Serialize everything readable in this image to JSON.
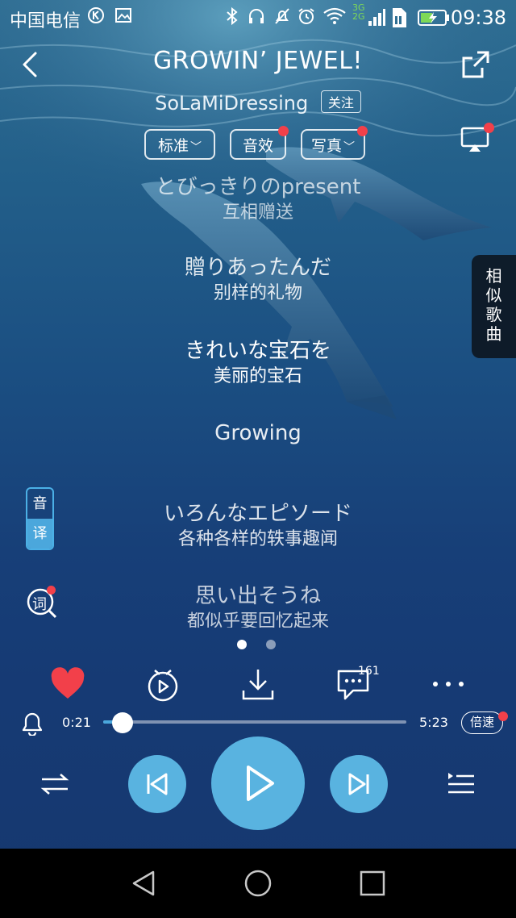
{
  "status_bar": {
    "carrier": "中国电信",
    "network_badge": "3G\n2G",
    "time": "09:38",
    "icons": [
      "k-icon",
      "image-icon",
      "bluetooth-icon",
      "headphones-icon",
      "mute-icon",
      "alarm-icon",
      "wifi-icon",
      "signal-icon",
      "sim-icon",
      "battery-charging-icon"
    ]
  },
  "header": {
    "title": "GROWIN’ JEWEL!",
    "artist": "SoLaMiDressing",
    "follow_label": "关注",
    "chips": [
      {
        "label": "标准",
        "has_dropdown": true,
        "has_dot": false
      },
      {
        "label": "音效",
        "has_dropdown": false,
        "has_dot": true
      },
      {
        "label": "写真",
        "has_dropdown": true,
        "has_dot": true
      }
    ]
  },
  "lyrics": [
    {
      "orig": "とびっきりのpresent",
      "trans": "互相赠送",
      "state": "dim"
    },
    {
      "orig": "贈りあったんだ",
      "trans": "别样的礼物",
      "state": "semi"
    },
    {
      "orig": "きれいな宝石を",
      "trans": "美丽的宝石",
      "state": "active"
    },
    {
      "orig": "Growing",
      "trans": "",
      "state": "semi"
    },
    {
      "orig": "いろんなエピソード",
      "trans": "各种各样的轶事趣闻",
      "state": "semi"
    },
    {
      "orig": "思い出そうね",
      "trans": "都似乎要回忆起来",
      "state": "dim"
    }
  ],
  "side": {
    "similar_songs": "相似歌曲",
    "translate_top": "音",
    "translate_bottom": "译",
    "lyric_search": "词"
  },
  "pager": {
    "pages": 2,
    "current": 1
  },
  "actions": {
    "comment_count": "161"
  },
  "player": {
    "current_time": "0:21",
    "total_time": "5:23",
    "progress": 0.065,
    "speed_label": "倍速"
  },
  "colors": {
    "accent": "#59b3e0",
    "like": "#f2404a",
    "dot": "#f2404a"
  }
}
